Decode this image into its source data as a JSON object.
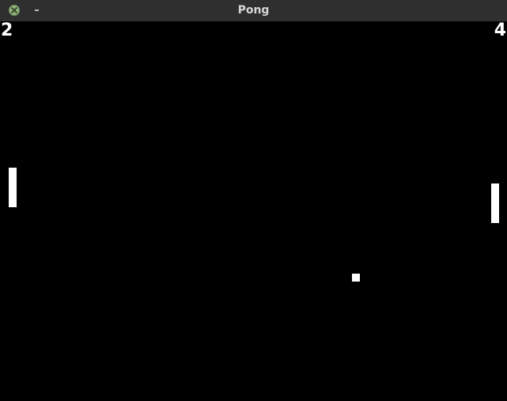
{
  "window": {
    "title": "Pong",
    "titlebar_color": "#2f2f2f",
    "close_button_color": "#8fb07a"
  },
  "game": {
    "background_color": "#000000",
    "foreground_color": "#ffffff",
    "score_left": "2",
    "score_right": "4"
  },
  "icons": {
    "close": "close-icon",
    "minimize": "minimize-icon"
  }
}
